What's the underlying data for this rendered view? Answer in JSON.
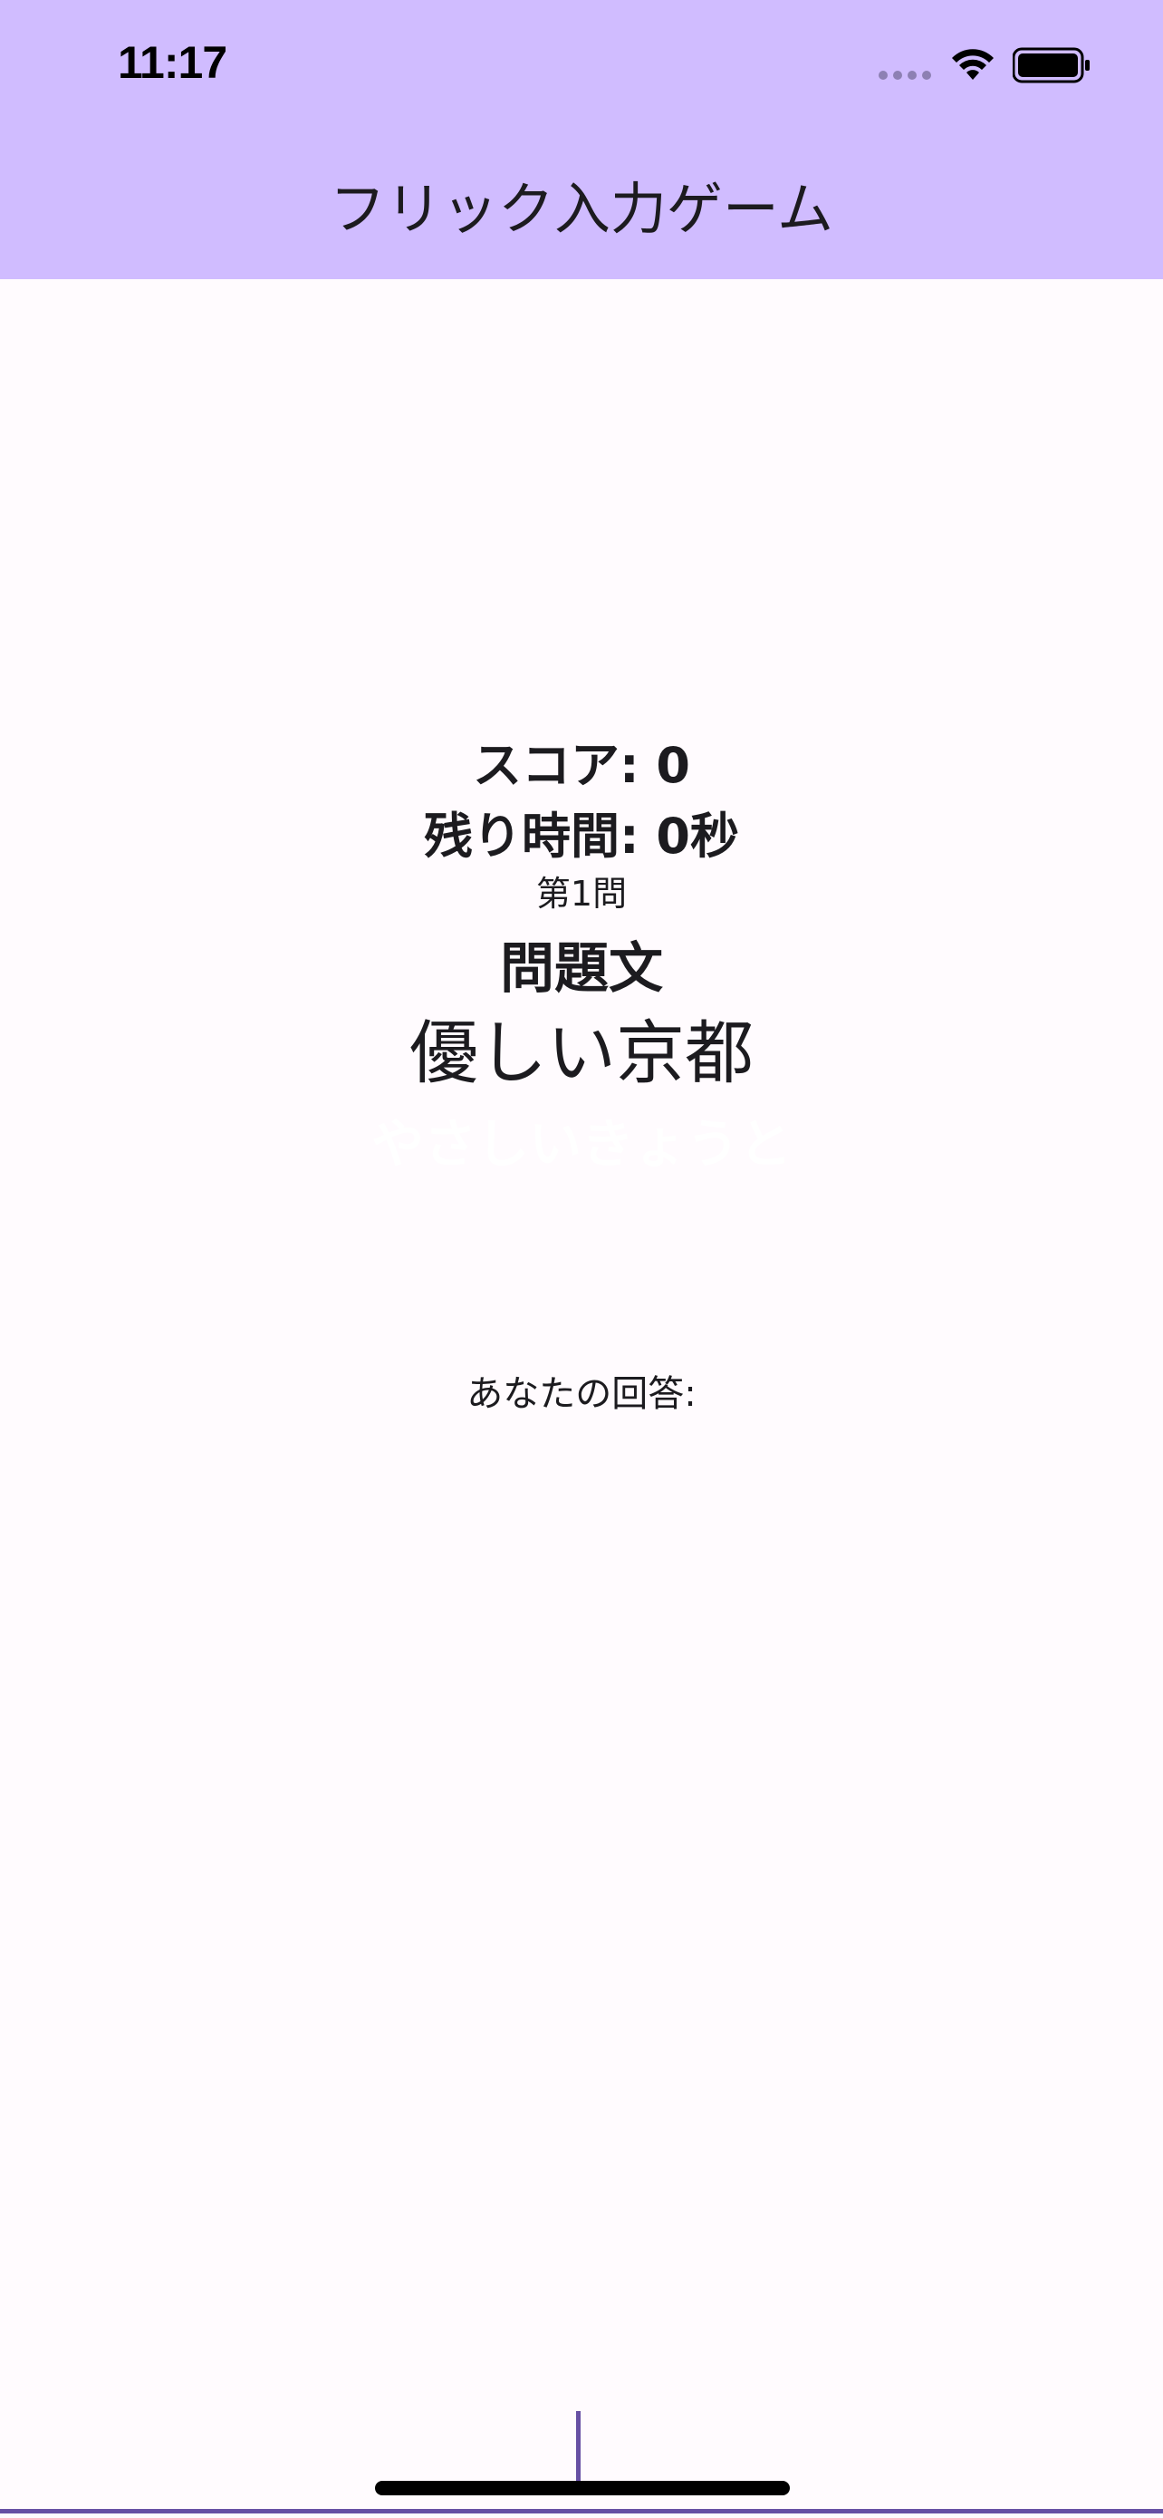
{
  "status_bar": {
    "time": "11:17",
    "icons": [
      "signal-dots-icon",
      "wifi-icon",
      "battery-icon"
    ]
  },
  "app_bar": {
    "title": "フリック入力ゲーム"
  },
  "game": {
    "score_label": "スコア: 0",
    "time_label": "残り時間: 0秒",
    "question_number": "第1問",
    "question_heading": "問題文",
    "question_text": "優しい京都",
    "reading_hint": "やさしいきょうと"
  },
  "answer": {
    "input_value": "",
    "label": "あなたの回答:"
  },
  "colors": {
    "app_bar": "#d0bcff",
    "accent": "#6750a4",
    "background": "#fffbfe",
    "text": "#1c1b1f"
  }
}
